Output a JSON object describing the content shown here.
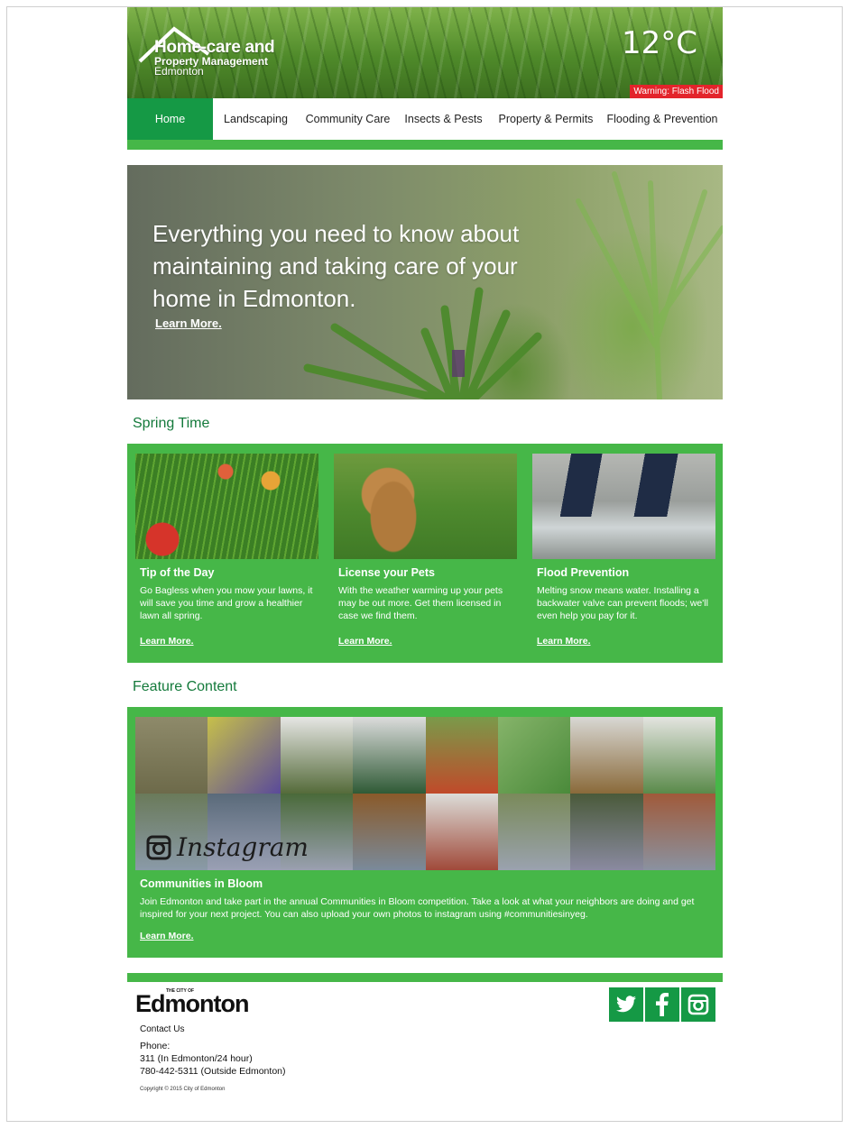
{
  "header": {
    "logo_line1": "Home-care and",
    "logo_line2": "Property Management",
    "logo_line3": "Edmonton",
    "temperature": "12°C",
    "warning": "Warning: Flash Flood"
  },
  "nav": {
    "items": [
      {
        "label": "Home",
        "active": true
      },
      {
        "label": "Landscaping"
      },
      {
        "label": "Community Care"
      },
      {
        "label": "Insects & Pests"
      },
      {
        "label": "Property & Permits"
      },
      {
        "label": "Flooding & Prevention"
      }
    ]
  },
  "hero": {
    "title": "Everything you need to know about maintaining and taking care of your home in Edmonton.",
    "link": "Learn More."
  },
  "spring": {
    "title": "Spring Time",
    "cards": [
      {
        "title": "Tip of the Day",
        "text": "Go Bagless when you mow your lawns, it will save you time and grow a healthier lawn all spring.",
        "link": "Learn More.",
        "image": "flowers-lawn"
      },
      {
        "title": "License your Pets",
        "text": "With the weather warming up your pets may be out more. Get them licensed in case we find them.",
        "link": "Learn More.",
        "image": "dog"
      },
      {
        "title": "Flood Prevention",
        "text": "Melting snow means water. Installing a backwater valve can prevent floods; we'll even help you pay for it.",
        "link": "Learn More.",
        "image": "feet-in-water"
      }
    ]
  },
  "feature": {
    "title": "Feature Content",
    "instagram_label": "Instagram",
    "item_title": "Communities in Bloom",
    "text": "Join Edmonton and take part in the annual Communities in Bloom competition. Take a look at what your neighbors are doing and get inspired for your next project. You can also upload your own photos to instagram using #communitiesinyeg.",
    "link": "Learn More."
  },
  "footer": {
    "logo_small": "THE CITY OF",
    "logo_text": "Edmonton",
    "contact": "Contact Us",
    "phone_label": "Phone:",
    "phone_1": "311 (In Edmonton/24 hour)",
    "phone_2": "780-442-5311 (Outside Edmonton)",
    "copyright": "Copyright © 2015 City of Edmonton",
    "social": [
      "twitter-icon",
      "facebook-icon",
      "instagram-icon"
    ]
  },
  "colors": {
    "brand_green": "#46b748",
    "dark_green": "#159945",
    "title_green": "#147a3b",
    "warning_red": "#e3242b"
  }
}
